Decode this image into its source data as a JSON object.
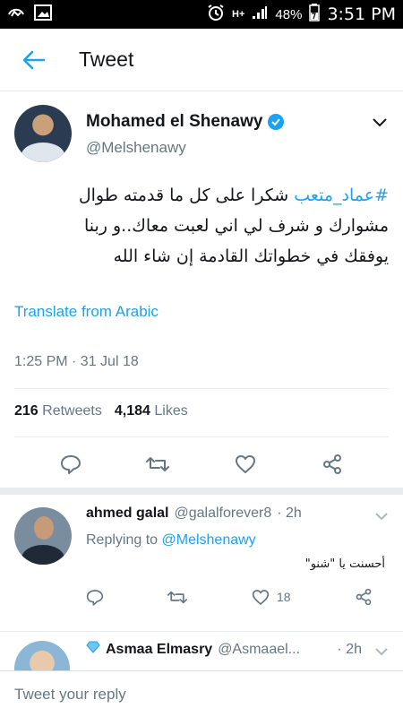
{
  "status_bar": {
    "battery": "48%",
    "time": "3:51 PM",
    "network": "H+"
  },
  "app_bar": {
    "title": "Tweet"
  },
  "tweet": {
    "author_name": "Mohamed el Shenawy",
    "author_handle": "@Melshenawy",
    "hashtag": "#عماد_متعب",
    "text_line1_rest": " شكرا على كل ما قدمته طوال",
    "text_line2": "مشوارك و شرف لي اني لعبت معاك..و ربنا",
    "text_line3": "يوفقك في خطواتك القادمة إن شاء الله",
    "translate": "Translate from Arabic",
    "timestamp": "1:25 PM · 31 Jul 18",
    "retweets_count": "216",
    "retweets_label": "Retweets",
    "likes_count": "4,184",
    "likes_label": "Likes"
  },
  "reply": {
    "name": "ahmed galal",
    "handle": "@galalforever8",
    "time": "· 2h",
    "replying_prefix": "Replying to",
    "replying_to": "@Melshenawy",
    "text": "أحسنت يا \"شنو\"",
    "like_count": "18"
  },
  "next_reply": {
    "name": "Asmaa Elmasry",
    "handle": "@Asmaael...",
    "time": "· 2h"
  },
  "composer": {
    "placeholder": "Tweet your reply"
  },
  "colors": {
    "accent": "#1da1f2",
    "muted": "#657786",
    "text": "#14171a",
    "divider": "#e6ecf0"
  }
}
